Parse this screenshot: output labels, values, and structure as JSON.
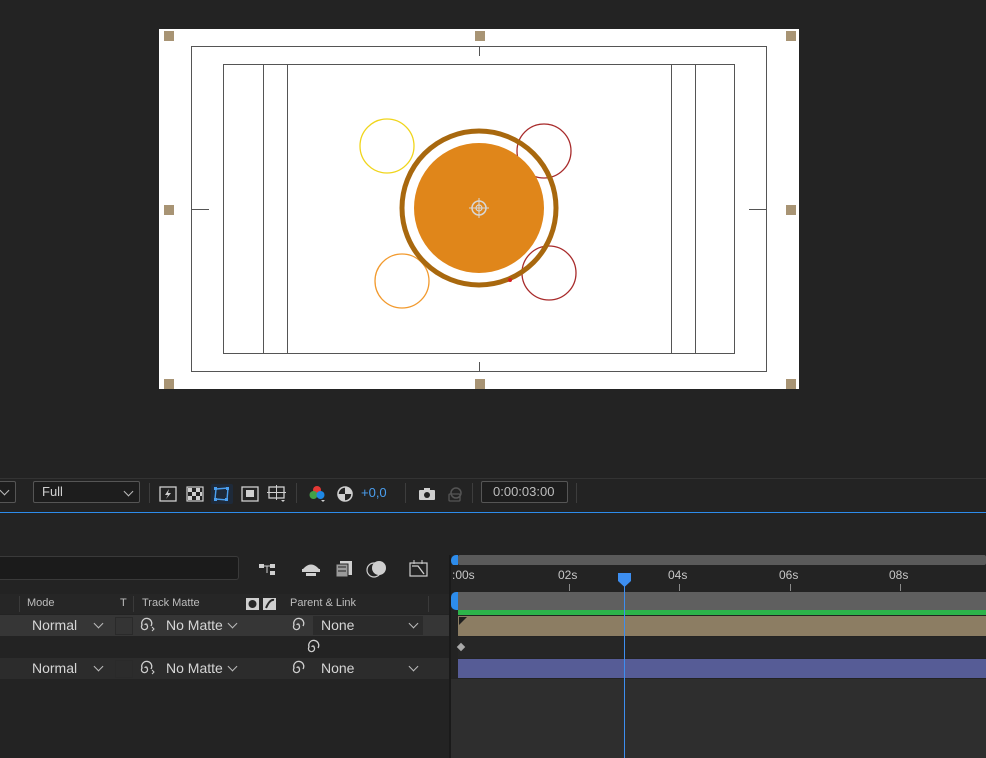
{
  "toolbar": {
    "resolution": "Full",
    "exposure_value": "+0,0",
    "timecode": "0:00:03:00",
    "colors": {
      "accent": "#2d8ceb"
    }
  },
  "timeline": {
    "headers": {
      "mode": "Mode",
      "t": "T",
      "track_matte": "Track Matte",
      "parent_link": "Parent & Link"
    },
    "ruler_ticks": [
      ":00s",
      "02s",
      "04s",
      "06s",
      "08s"
    ],
    "layers": [
      {
        "mode": "Normal",
        "track_matte": "No Matte",
        "parent": "None",
        "bar_color": "#8c7d63"
      },
      {
        "mode": "Normal",
        "track_matte": "No Matte",
        "parent": "None",
        "bar_color": "#565c96"
      }
    ]
  },
  "composition": {
    "icons": [
      "anchor-point-icon",
      "transform-handle-icon"
    ],
    "colors": {
      "main_circle": "#e0861a",
      "ring": "#a8680e",
      "yellow": "#f0d51c",
      "orange": "#f29a2e",
      "red": "#a82b2b"
    }
  }
}
